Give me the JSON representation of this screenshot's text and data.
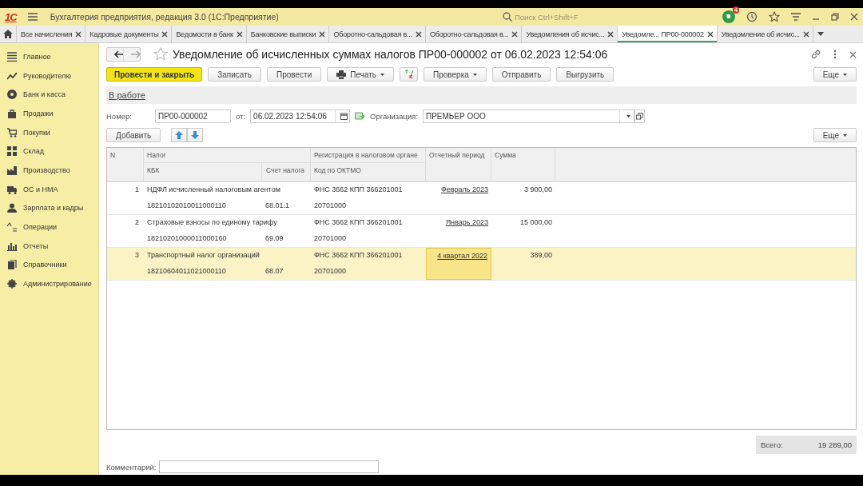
{
  "app_bar": {
    "logo": "1С",
    "title": "Бухгалтерия предприятия, редакция 3.0  (1С:Предприятие)",
    "search": {
      "placeholder": "Поиск Ctrl+Shift+F"
    },
    "notifications": "4"
  },
  "tabs": [
    {
      "label": "Все начисления",
      "selected": false
    },
    {
      "label": "Кадровые документы",
      "selected": false
    },
    {
      "label": "Ведомости в банк",
      "selected": false
    },
    {
      "label": "Банковские выписки",
      "selected": false
    },
    {
      "label": "Оборотно-сальдовая в...",
      "selected": false
    },
    {
      "label": "Оборотно-сальдовая в...",
      "selected": false
    },
    {
      "label": "Уведомления об исчис...",
      "selected": false
    },
    {
      "label": "Уведомле... ПР00-000002",
      "selected": true
    },
    {
      "label": "Уведомление об исчис...",
      "selected": false
    }
  ],
  "sidebar": {
    "items": [
      {
        "label": "Главное"
      },
      {
        "label": "Руководителю"
      },
      {
        "label": "Банк и касса"
      },
      {
        "label": "Продажи"
      },
      {
        "label": "Покупки"
      },
      {
        "label": "Склад"
      },
      {
        "label": "Производство"
      },
      {
        "label": "ОС и НМА"
      },
      {
        "label": "Зарплата и кадры"
      },
      {
        "label": "Операции"
      },
      {
        "label": "Отчеты"
      },
      {
        "label": "Справочники"
      },
      {
        "label": "Администрирование"
      }
    ]
  },
  "document": {
    "title": "Уведомление об исчисленных суммах налогов ПР00-000002 от 06.02.2023 12:54:06",
    "toolbar": [
      {
        "label": "Провести и закрыть",
        "kind": "primary"
      },
      {
        "label": "Записать",
        "kind": "button"
      },
      {
        "label": "Провести",
        "kind": "button"
      },
      {
        "label": "Печать",
        "kind": "print"
      },
      {
        "kind": "dtkt"
      },
      {
        "label": "Проверка",
        "kind": "menu"
      },
      {
        "label": "Отправить",
        "kind": "button"
      },
      {
        "label": "Выгрузить",
        "kind": "button"
      }
    ],
    "more": "Еще",
    "status_link": "В работе",
    "fields": {
      "number_label": "Номер:",
      "number": "ПР00-000002",
      "date_label": "от:",
      "date": "06.02.2023 12:54:06",
      "org_label": "Организация:",
      "org": "ПРЕМЬЕР ООО"
    },
    "table_toolbar": {
      "add": "Добавить",
      "more": "Еще"
    },
    "table": {
      "columns": {
        "n": "N",
        "tax": "Налог",
        "kbk": "КБК",
        "account": "Счет налога",
        "registration": "Регистрация в налоговом органе",
        "oktmo": "Код по ОКТМО",
        "period": "Отчетный период",
        "sum": "Сумма"
      },
      "rows": [
        {
          "n": "1",
          "tax": "НДФЛ исчисленный налоговым агентом",
          "kbk": "18210102010011000110",
          "account": "68.01.1",
          "registration": "ФНС 3662 КПП 366201001",
          "oktmo": "20701000",
          "period": "Февраль 2023",
          "sum": "3 900,00",
          "selected": false
        },
        {
          "n": "2",
          "tax": "Страховые взносы по единому тарифу",
          "kbk": "18210201000011000160",
          "account": "69.09",
          "registration": "ФНС 3662 КПП 366201001",
          "oktmo": "20701000",
          "period": "Январь 2023",
          "sum": "15 000,00",
          "selected": false
        },
        {
          "n": "3",
          "tax": "Транспортный налог организаций",
          "kbk": "18210604011021000110",
          "account": "68.07",
          "registration": "ФНС 3662 КПП 366201001",
          "oktmo": "20701000",
          "period": "4 квартал 2022",
          "sum": "389,00",
          "selected": true
        }
      ]
    },
    "total_label": "Всего:",
    "total": "19 289,00",
    "comment_label": "Комментарий:"
  }
}
